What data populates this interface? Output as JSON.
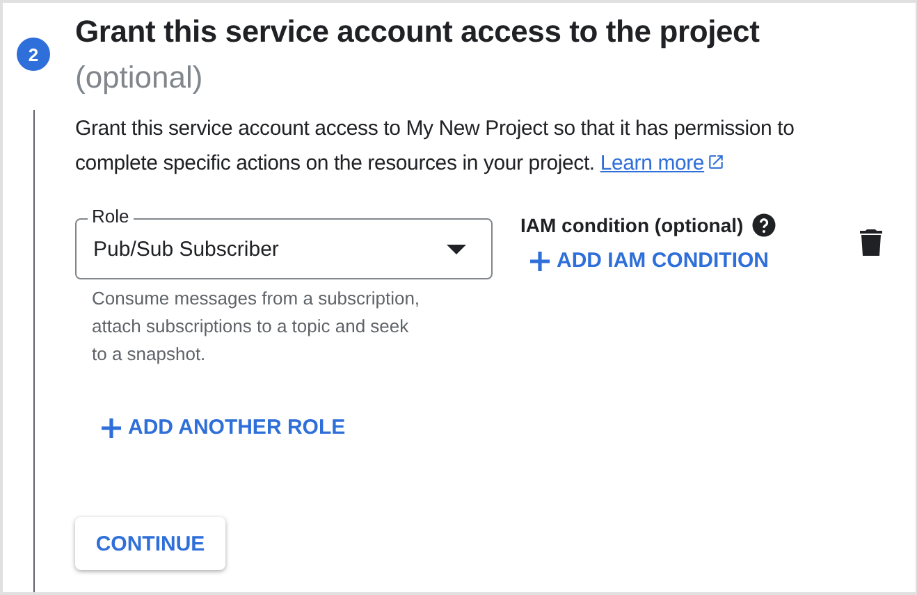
{
  "step": {
    "number": "2",
    "title": "Grant this service account access to the project",
    "title_suffix": "(optional)"
  },
  "description": {
    "text": "Grant this service account access to My New Project so that it has permission to complete specific actions on the resources in your project.",
    "link": "Learn more"
  },
  "role_field": {
    "label": "Role",
    "value": "Pub/Sub Subscriber",
    "helper": "Consume messages from a subscription, attach subscriptions to a topic and seek to a snapshot."
  },
  "iam_condition": {
    "label": "IAM condition (optional)",
    "add_button": "ADD IAM CONDITION"
  },
  "add_role_button": "ADD ANOTHER ROLE",
  "continue_button": "CONTINUE"
}
